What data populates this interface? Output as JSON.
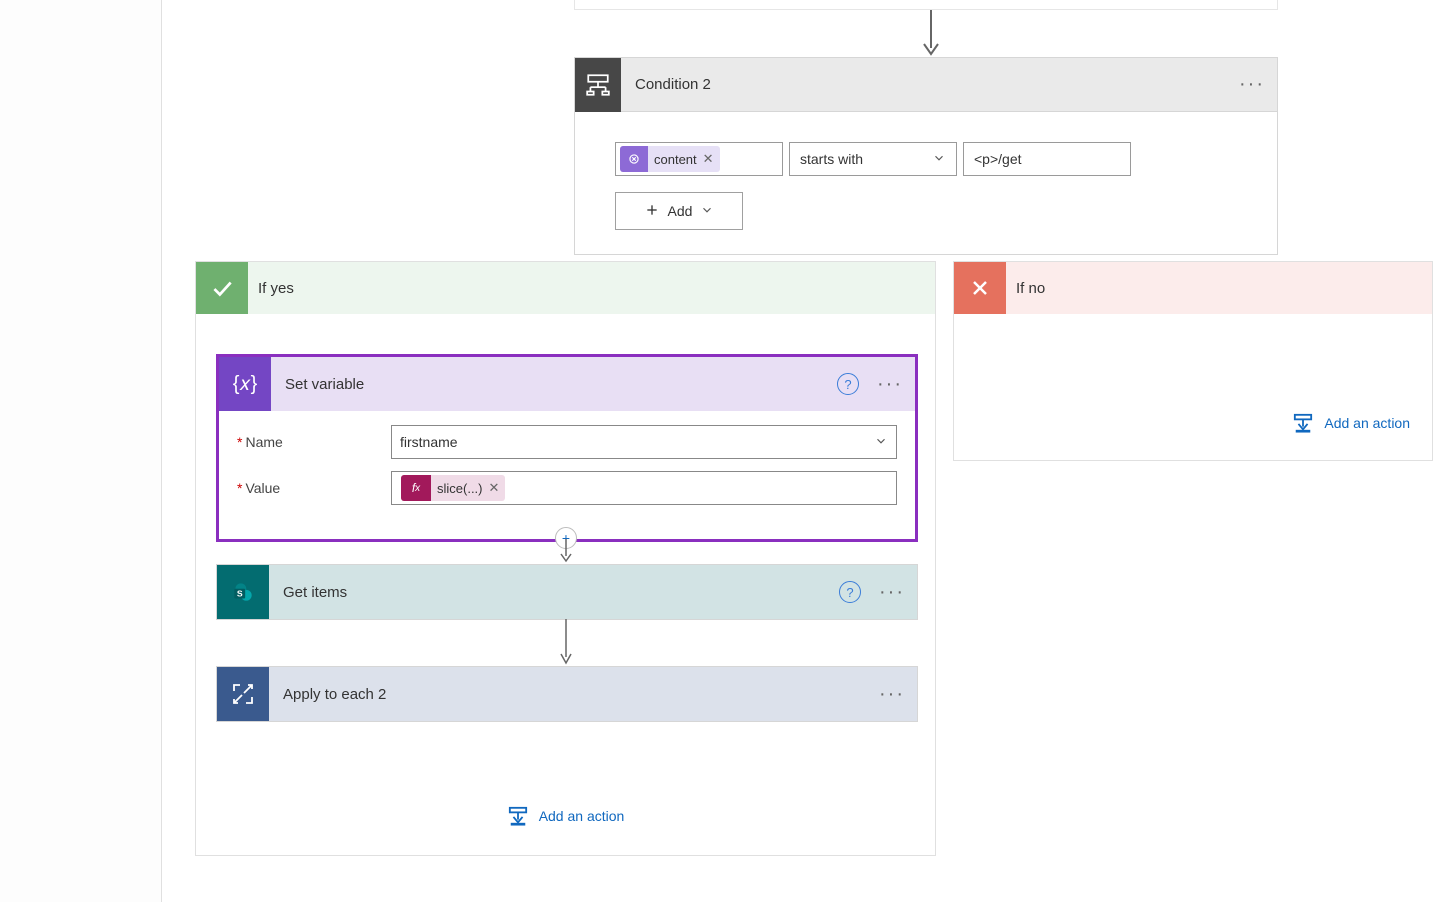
{
  "condition": {
    "title": "Condition 2",
    "left_token": "content",
    "operator": "starts with",
    "value": "<p>/get",
    "add_label": "Add"
  },
  "branches": {
    "yes_label": "If yes",
    "no_label": "If no"
  },
  "set_variable": {
    "title": "Set variable",
    "name_label": "Name",
    "name_value": "firstname",
    "value_label": "Value",
    "value_token": "slice(...)"
  },
  "get_items": {
    "title": "Get items"
  },
  "apply_each": {
    "title": "Apply to each 2"
  },
  "add_action_label": "Add an action"
}
